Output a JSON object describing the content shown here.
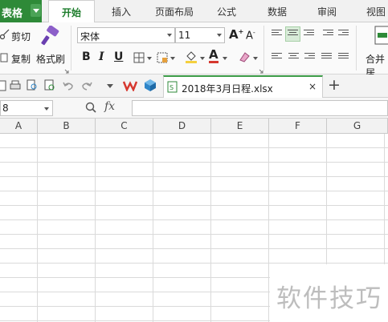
{
  "app_button": {
    "label": "表格"
  },
  "menu_tabs": [
    {
      "label": "开始",
      "active": true
    },
    {
      "label": "插入"
    },
    {
      "label": "页面布局"
    },
    {
      "label": "公式"
    },
    {
      "label": "数据"
    },
    {
      "label": "审阅"
    },
    {
      "label": "视图"
    }
  ],
  "ribbon": {
    "cut_label": "剪切",
    "copy_label": "复制",
    "format_painter_label": "格式刷",
    "font_name": "宋体",
    "font_size": "11",
    "bold": "B",
    "italic": "I",
    "underline": "U",
    "font_color_glyph": "A",
    "merge_label": "合并居"
  },
  "doc_tab": {
    "name": "2018年3月日程.xlsx",
    "close": "×",
    "new_tab": "+"
  },
  "formula_bar": {
    "name_box": "8",
    "fx": "fx",
    "formula": ""
  },
  "columns": [
    "A",
    "B",
    "C",
    "D",
    "E",
    "F",
    "G"
  ],
  "watermark": "软件技巧",
  "colors": {
    "accent_green": "#2e8a38",
    "active_tab_text": "#1e7d2c",
    "wps_red": "#d6382f",
    "icon_blue": "#2f86c9"
  }
}
